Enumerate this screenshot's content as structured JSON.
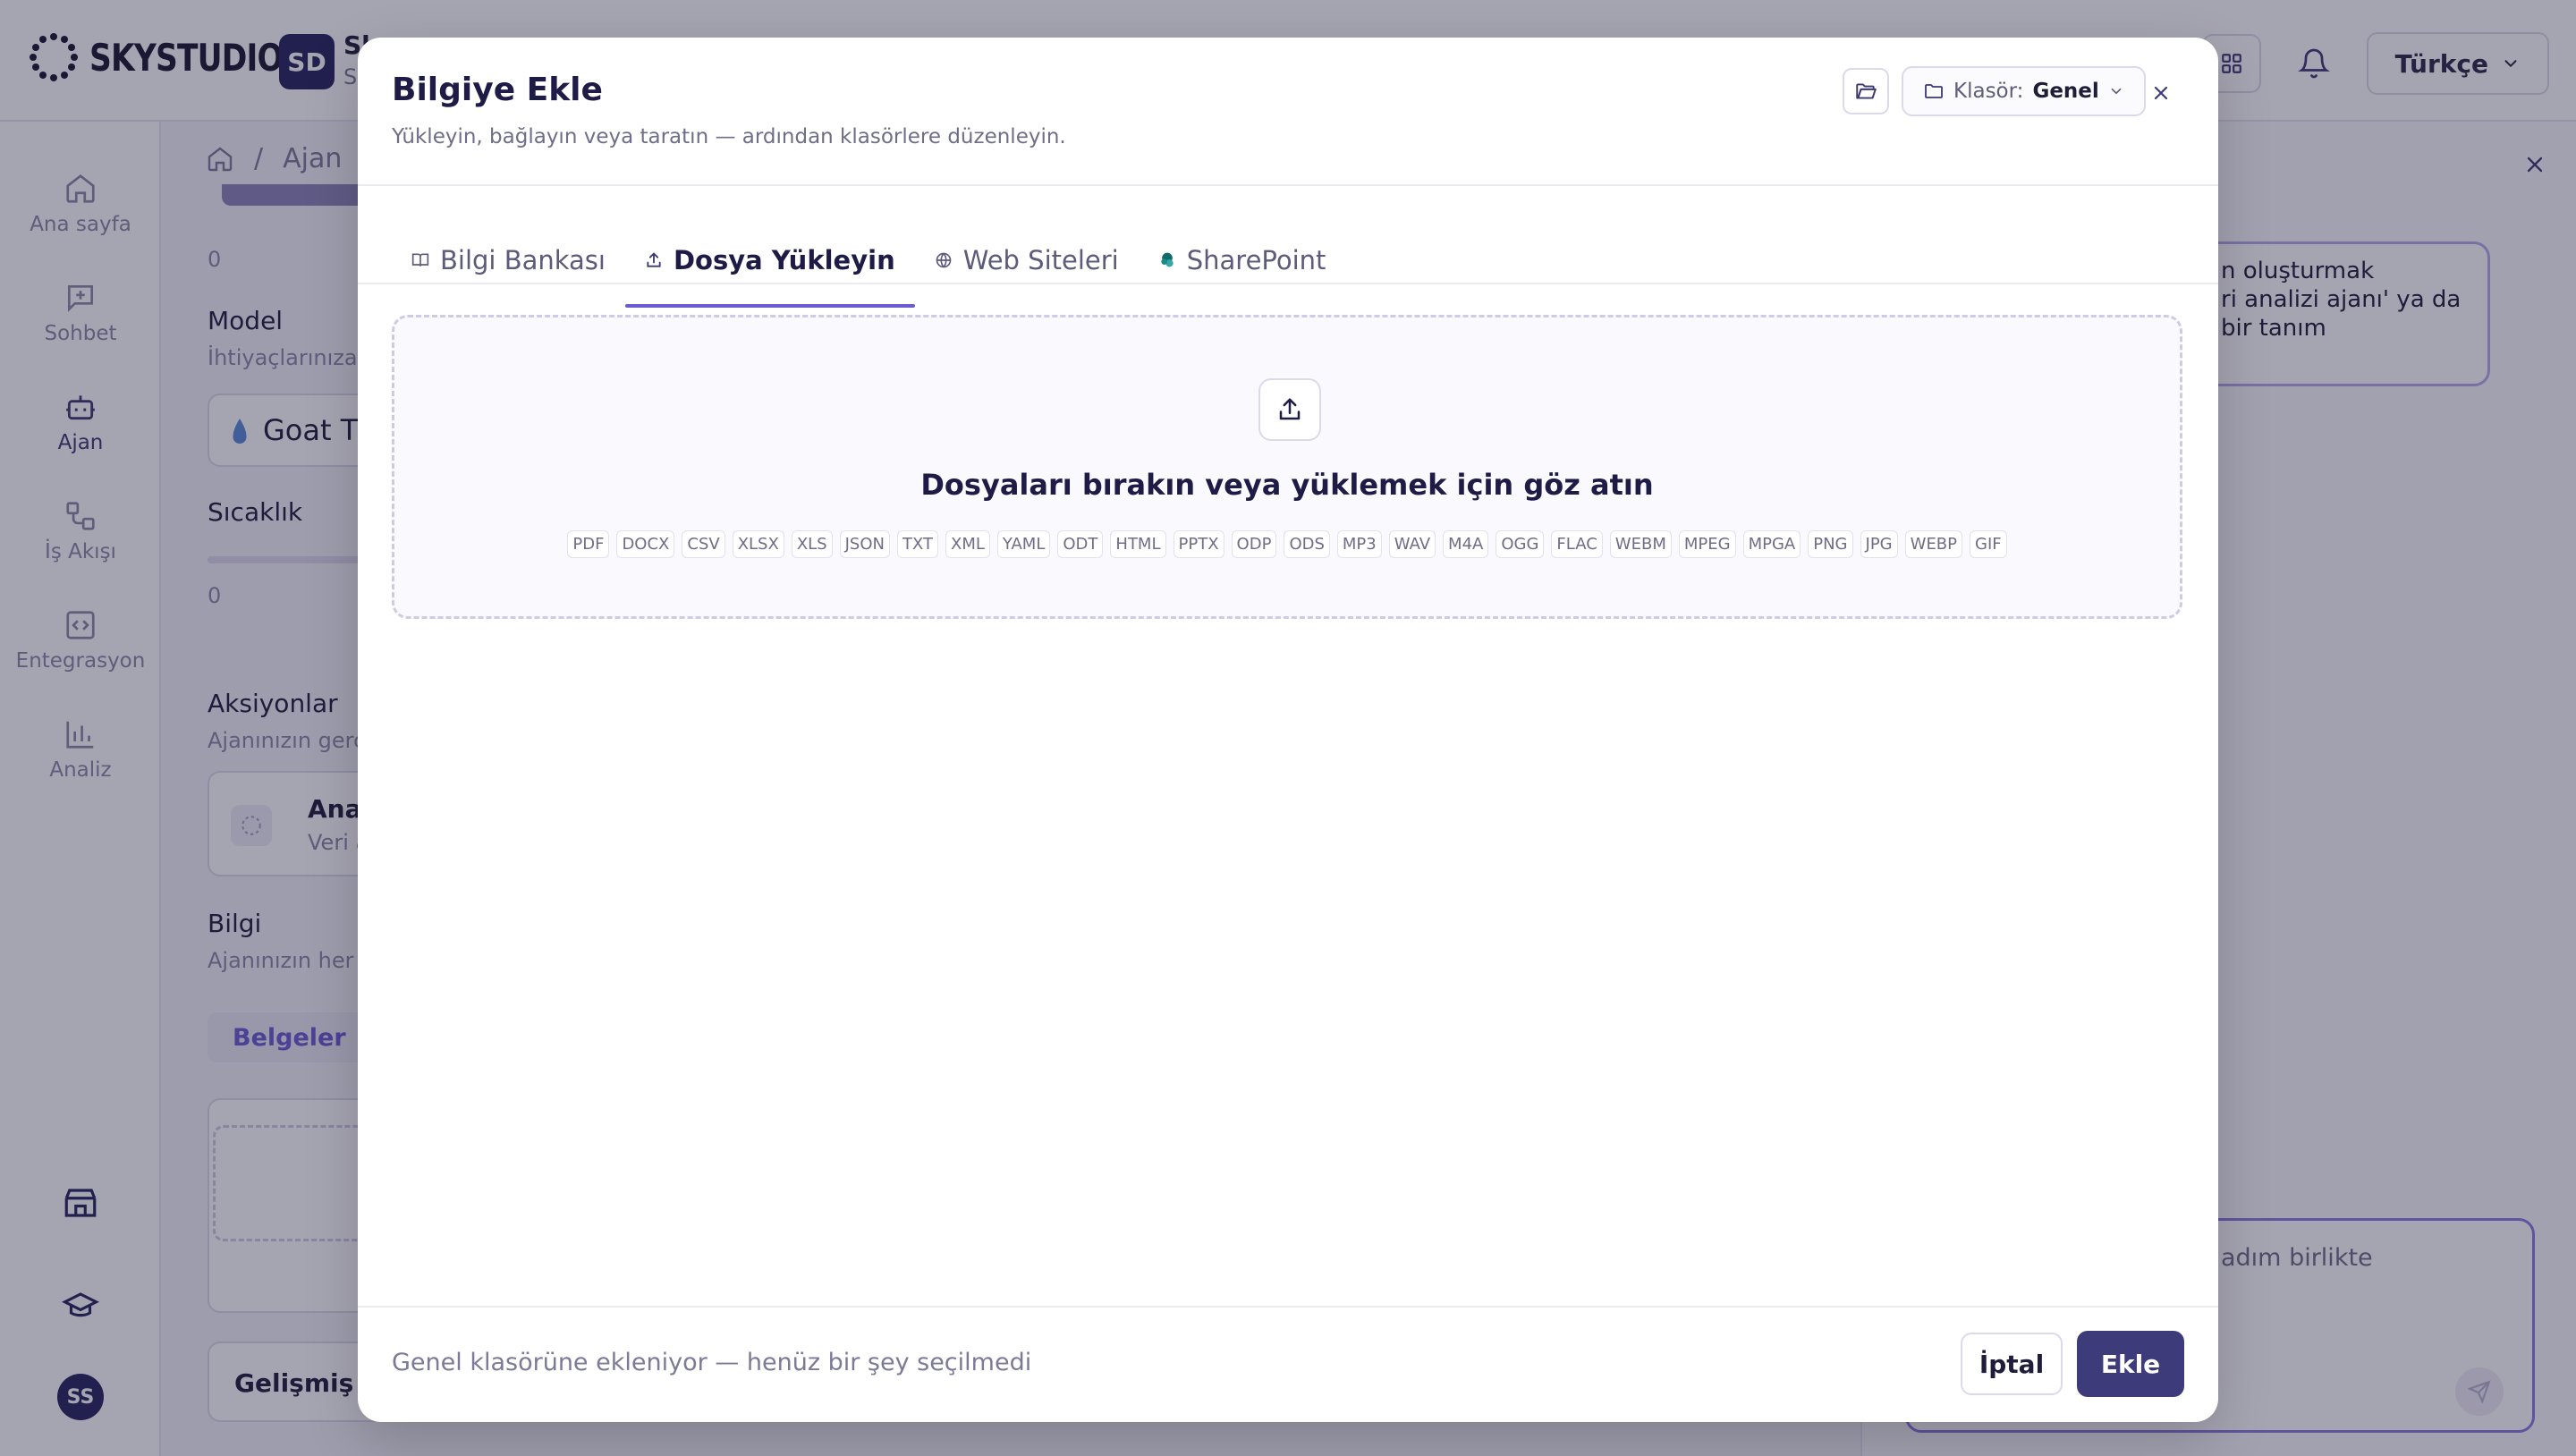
{
  "app": {
    "logo_text": "SKYSTUDIO",
    "workspace_badge": "SD",
    "workspace_name": "Sk",
    "workspace_sub": "S",
    "language": "Türkçe"
  },
  "sidebar": {
    "items": [
      {
        "label": "Ana sayfa",
        "icon": "home-icon"
      },
      {
        "label": "Sohbet",
        "icon": "chat-icon"
      },
      {
        "label": "Ajan",
        "icon": "bot-icon"
      },
      {
        "label": "İş Akışı",
        "icon": "workflow-icon"
      },
      {
        "label": "Entegrasyon",
        "icon": "code-icon"
      },
      {
        "label": "Analiz",
        "icon": "chart-icon"
      }
    ],
    "avatar_initials": "SS"
  },
  "breadcrumb": {
    "items": [
      "Ajan"
    ]
  },
  "background": {
    "zero1": "0",
    "model_label": "Model",
    "model_sub": "İhtiyaçlarınıza e",
    "model_value": "Goat Th",
    "temp_label": "Sıcaklık",
    "zero2": "0",
    "actions_label": "Aksiyonlar",
    "actions_sub": "Ajanınızın gerç",
    "action_title": "Ana",
    "action_sub": "Veri a",
    "info_label": "Bilgi",
    "info_sub": "Ajanınızın her z",
    "docs_tab": "Belgeler",
    "advanced": "Gelişmiş ay",
    "prompt_lines": [
      "n oluşturmak",
      "ri analizi ajanı' ya da",
      "bir tanım"
    ],
    "chat_input": "adım birlikte"
  },
  "modal": {
    "title": "Bilgiye Ekle",
    "subtitle": "Yükleyin, bağlayın veya taratın — ardından klasörlere düzenleyin.",
    "folder_prefix": "Klasör:",
    "folder_value": "Genel",
    "tabs": [
      {
        "label": "Bilgi Bankası",
        "icon": "book-icon",
        "active": false
      },
      {
        "label": "Dosya Yükleyin",
        "icon": "upload-icon",
        "active": true
      },
      {
        "label": "Web Siteleri",
        "icon": "globe-icon",
        "active": false
      },
      {
        "label": "SharePoint",
        "icon": "sharepoint-icon",
        "active": false
      }
    ],
    "dropzone": {
      "title": "Dosyaları bırakın veya yüklemek için göz atın",
      "formats": [
        "PDF",
        "DOCX",
        "CSV",
        "XLSX",
        "XLS",
        "JSON",
        "TXT",
        "XML",
        "YAML",
        "ODT",
        "HTML",
        "PPTX",
        "ODP",
        "ODS",
        "MP3",
        "WAV",
        "M4A",
        "OGG",
        "FLAC",
        "WEBM",
        "MPEG",
        "MPGA",
        "PNG",
        "JPG",
        "WEBP",
        "GIF"
      ]
    },
    "footer_status": "Genel klasörüne ekleniyor — henüz bir şey seçilmedi",
    "cancel_label": "İptal",
    "add_label": "Ekle"
  },
  "colors": {
    "accent": "#6a5bd0",
    "primary_button": "#3d3b7a",
    "title": "#1e1c46"
  }
}
